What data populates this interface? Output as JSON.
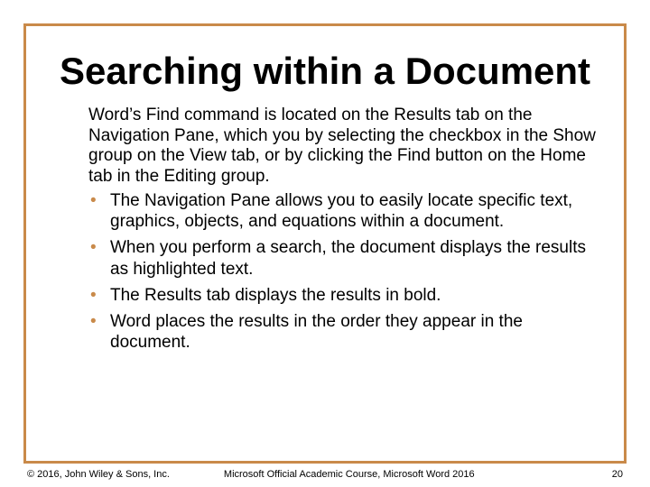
{
  "title": "Searching within a Document",
  "intro": "Word’s Find command is located on the Results tab on the Navigation Pane, which you by selecting the checkbox in the Show group on the View tab, or by clicking the Find button on the Home tab in the Editing group.",
  "bullets": [
    "The Navigation Pane allows you to easily locate specific text, graphics, objects, and equations within a document.",
    "When you perform a search, the document displays the results as highlighted text.",
    "The Results tab displays the results in bold.",
    "Word places the results in the order they appear in the document."
  ],
  "footer": {
    "left": "© 2016, John Wiley & Sons, Inc.",
    "center": "Microsoft Official Academic Course, Microsoft Word 2016",
    "right": "20"
  }
}
